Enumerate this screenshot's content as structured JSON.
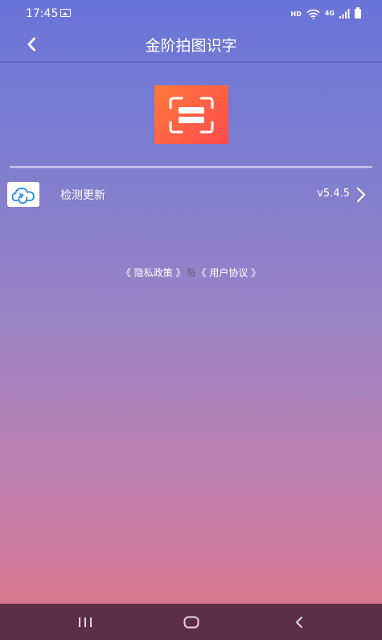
{
  "status_bar": {
    "time": "17:45",
    "hd": "HD",
    "network": "4G"
  },
  "header": {
    "title": "金阶拍图识字"
  },
  "update_row": {
    "label": "检测更新",
    "version": "v5.4.5"
  },
  "links": {
    "privacy": "《 隐私政策 》",
    "separator": "与",
    "agreement": "《 用户协议 》"
  },
  "icons": {
    "back": "chevron-left-icon",
    "logo": "scan-frame-icon",
    "update": "cloud-refresh-icon",
    "more": "chevron-right-icon",
    "nav_recents": "recents-icon",
    "nav_home": "home-icon",
    "nav_back": "back-icon"
  },
  "colors": {
    "gradient_top": "#6a74d8",
    "gradient_bottom": "#dc7385",
    "logo_orange": "#ff7a3a",
    "logo_red": "#ff4a4e",
    "nav_bar": "#5b2f45"
  }
}
